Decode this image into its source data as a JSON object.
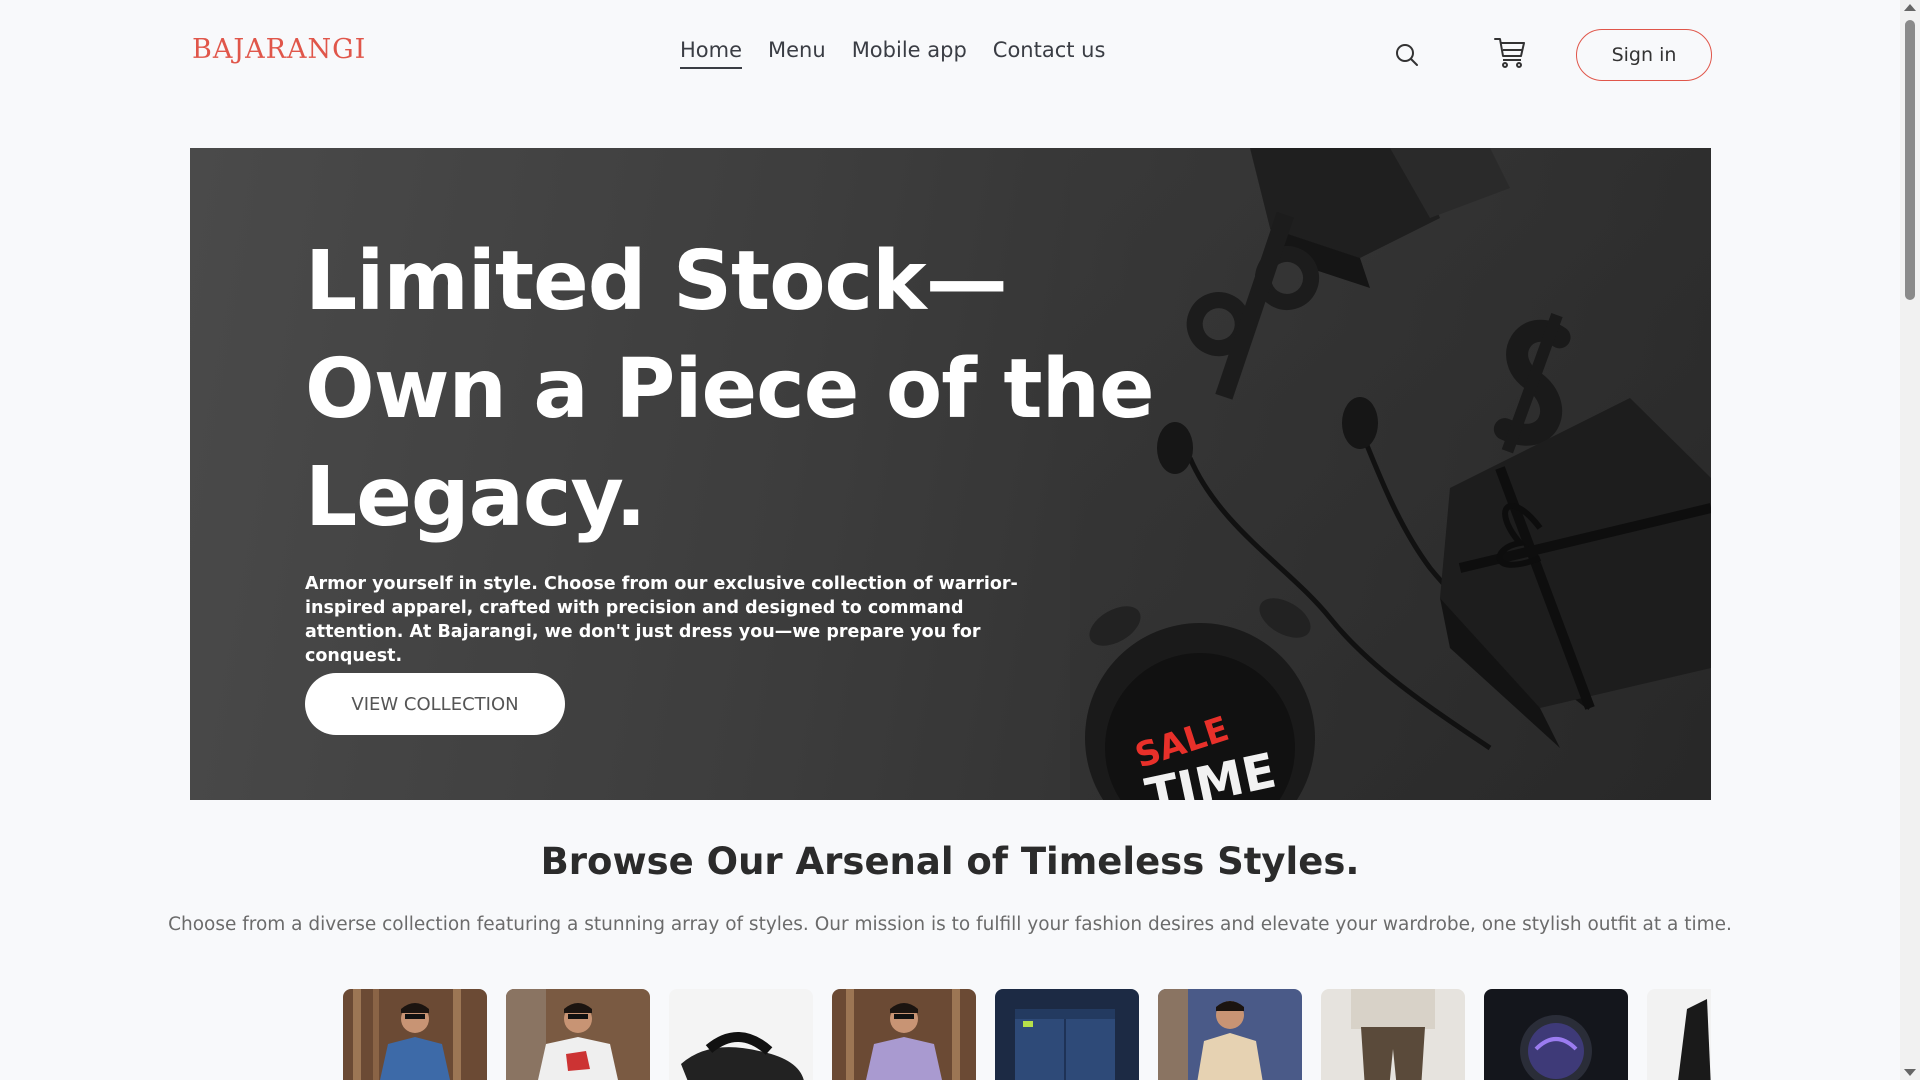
{
  "brand": {
    "logo": "BAJARANGI",
    "accent": "#e0564a"
  },
  "nav": {
    "items": [
      {
        "label": "Home",
        "active": true
      },
      {
        "label": "Menu",
        "active": false
      },
      {
        "label": "Mobile app",
        "active": false
      },
      {
        "label": "Contact us",
        "active": false
      }
    ],
    "search_icon": "search-icon",
    "cart_icon": "cart-icon",
    "signin_label": "Sign in"
  },
  "hero": {
    "title_lines": [
      "Limited Stock—",
      "Own a Piece of the",
      "Legacy."
    ],
    "description": "Armor yourself in style. Choose from our exclusive collection of warrior-inspired apparel, crafted with precision and designed to command attention. At Bajarangi, we don't just dress you—we prepare you for conquest.",
    "cta_label": "VIEW COLLECTION",
    "sale_text": "SALE TIME"
  },
  "section": {
    "title": "Browse Our Arsenal of Timeless Styles.",
    "subtitle": "Choose from a diverse collection featuring a stunning array of styles. Our mission is to fulfill your fashion desires and elevate your wardrobe, one stylish outfit at a time."
  },
  "products": [
    {
      "name": "blue-shirt-thumb"
    },
    {
      "name": "white-tshirt-thumb"
    },
    {
      "name": "sandal-thumb"
    },
    {
      "name": "lavender-shirt-thumb"
    },
    {
      "name": "jeans-thumb"
    },
    {
      "name": "kurta-thumb"
    },
    {
      "name": "trousers-thumb"
    },
    {
      "name": "smartwatch-thumb"
    },
    {
      "name": "jacket-thumb"
    }
  ]
}
